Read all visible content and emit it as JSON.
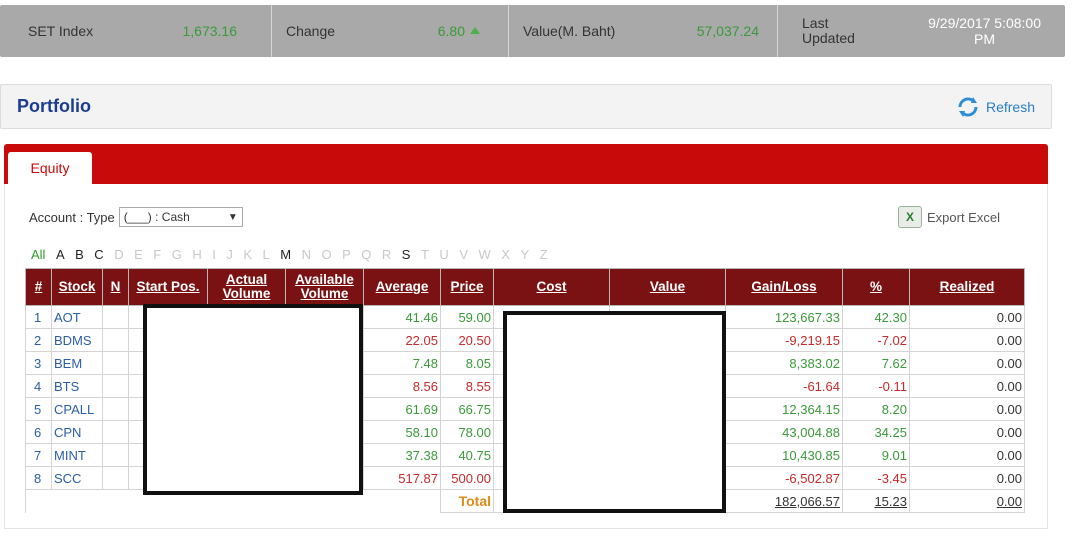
{
  "topbar": {
    "set_index_label": "SET Index",
    "set_index_value": "1,673.16",
    "change_label": "Change",
    "change_value": "6.80",
    "value_label": "Value(M. Baht)",
    "value_value": "57,037.24",
    "last_updated_label_1": "Last",
    "last_updated_label_2": "Updated",
    "last_updated_date": "9/29/2017 5:08:00",
    "last_updated_time": "PM"
  },
  "portfolio": {
    "title": "Portfolio",
    "refresh_label": "Refresh"
  },
  "tabs": {
    "equity": "Equity"
  },
  "account": {
    "label": "Account : Type",
    "selected": "(___)  : Cash",
    "caret": "▼"
  },
  "export_label": "Export Excel",
  "letters": [
    "All",
    "A",
    "B",
    "C",
    "D",
    "E",
    "F",
    "G",
    "H",
    "I",
    "J",
    "K",
    "L",
    "M",
    "N",
    "O",
    "P",
    "Q",
    "R",
    "S",
    "T",
    "U",
    "V",
    "W",
    "X",
    "Y",
    "Z"
  ],
  "active_letters": [
    "All",
    "A",
    "B",
    "C",
    "M",
    "S"
  ],
  "table": {
    "headers": {
      "idx": "#",
      "stock": "Stock",
      "n": "N",
      "start_pos": "Start Pos.",
      "actual_volume_1": "Actual",
      "actual_volume_2": "Volume",
      "available_volume_1": "Available",
      "available_volume_2": "Volume",
      "average": "Average",
      "price": "Price",
      "cost": "Cost",
      "value": "Value",
      "gain_loss": "Gain/Loss",
      "pct": "%",
      "realized": "Realized"
    },
    "rows": [
      {
        "idx": "1",
        "stock": "AOT",
        "average": "41.46",
        "price": "59.00",
        "gain": "123,667.33",
        "pct": "42.30",
        "realized": "0.00",
        "dir": "up"
      },
      {
        "idx": "2",
        "stock": "BDMS",
        "average": "22.05",
        "price": "20.50",
        "gain": "-9,219.15",
        "pct": "-7.02",
        "realized": "0.00",
        "dir": "down"
      },
      {
        "idx": "3",
        "stock": "BEM",
        "average": "7.48",
        "price": "8.05",
        "gain": "8,383.02",
        "pct": "7.62",
        "realized": "0.00",
        "dir": "up"
      },
      {
        "idx": "4",
        "stock": "BTS",
        "average": "8.56",
        "price": "8.55",
        "gain": "-61.64",
        "pct": "-0.11",
        "realized": "0.00",
        "dir": "down"
      },
      {
        "idx": "5",
        "stock": "CPALL",
        "average": "61.69",
        "price": "66.75",
        "gain": "12,364.15",
        "pct": "8.20",
        "realized": "0.00",
        "dir": "up"
      },
      {
        "idx": "6",
        "stock": "CPN",
        "average": "58.10",
        "price": "78.00",
        "gain": "43,004.88",
        "pct": "34.25",
        "realized": "0.00",
        "dir": "up"
      },
      {
        "idx": "7",
        "stock": "MINT",
        "average": "37.38",
        "price": "40.75",
        "gain": "10,430.85",
        "pct": "9.01",
        "realized": "0.00",
        "dir": "up"
      },
      {
        "idx": "8",
        "stock": "SCC",
        "average": "517.87",
        "price": "500.00",
        "gain": "-6,502.87",
        "pct": "-3.45",
        "realized": "0.00",
        "dir": "down"
      }
    ],
    "total": {
      "label": "Total",
      "gain": "182,066.57",
      "pct": "15.23",
      "realized": "0.00"
    }
  },
  "colors": {
    "up": "#3a9a3a",
    "down": "#c62a2a",
    "header_bg": "#7a1214",
    "tab_red": "#c80a0a",
    "title_blue": "#1b3d8f"
  }
}
